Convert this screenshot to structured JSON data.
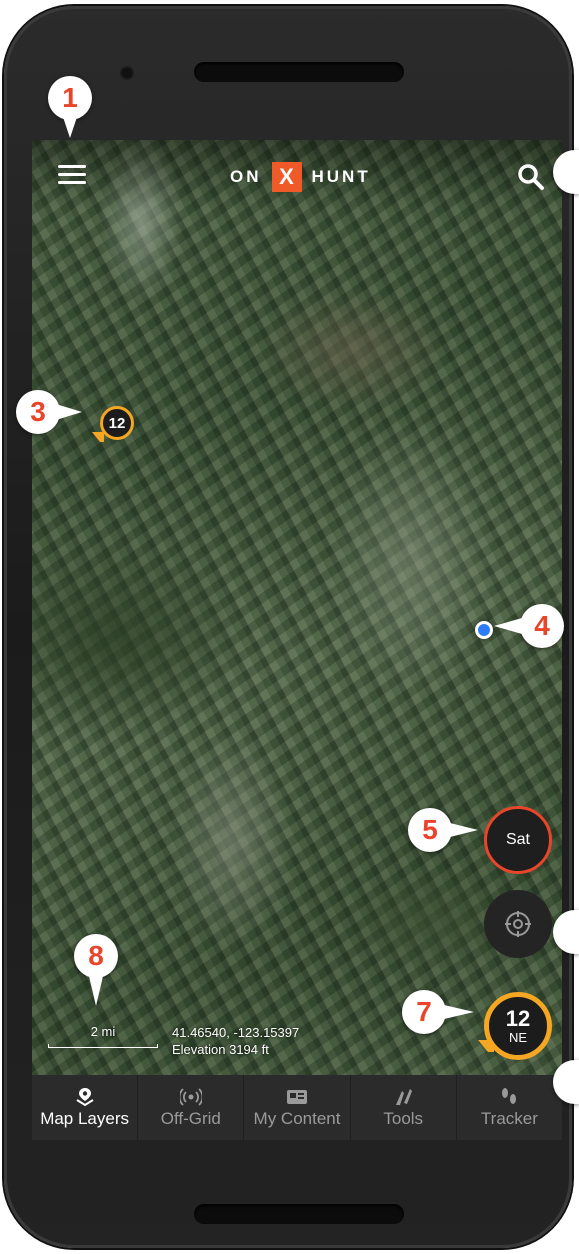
{
  "app": {
    "logo_left": "ON",
    "logo_mark": "X",
    "logo_right": "HUNT",
    "accent_color": "#f05a28"
  },
  "map": {
    "waypoint_label": "12",
    "scale_label": "2 mi",
    "coordinates": "41.46540, -123.15397",
    "elevation": "Elevation 3194 ft"
  },
  "controls": {
    "basemap_label": "Sat",
    "zoom_level": "12",
    "compass_heading": "NE"
  },
  "nav": {
    "items": [
      {
        "label": "Map Layers",
        "icon": "map-layers-icon",
        "active": true
      },
      {
        "label": "Off-Grid",
        "icon": "off-grid-icon",
        "active": false
      },
      {
        "label": "My Content",
        "icon": "my-content-icon",
        "active": false
      },
      {
        "label": "Tools",
        "icon": "tools-icon",
        "active": false
      },
      {
        "label": "Tracker",
        "icon": "tracker-icon",
        "active": false
      }
    ]
  },
  "callouts": [
    "1",
    "3",
    "4",
    "5",
    "7",
    "8"
  ]
}
